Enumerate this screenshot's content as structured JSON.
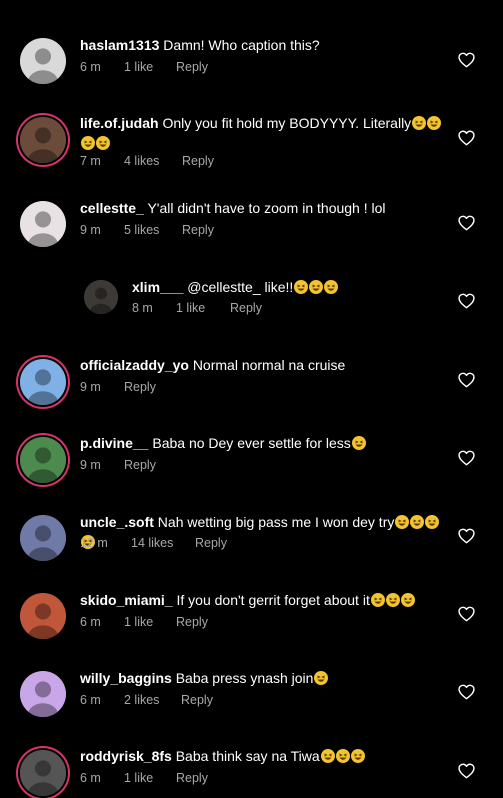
{
  "comments": [
    {
      "user": "haslam1313",
      "text": "Damn! Who caption this?",
      "emojis": 0,
      "time": "6 m",
      "likes": "1 like",
      "reply": "Reply",
      "avatar_color": "#d9d9d9"
    },
    {
      "user": "life.of.judah",
      "text": "Only you fit hold my BODYYYY. Literally",
      "emojis": 4,
      "time": "7 m",
      "likes": "4 likes",
      "reply": "Reply",
      "avatar_color": "#6b4b3a"
    },
    {
      "user": "cellestte_",
      "text": "Y'all didn't have to zoom in though ! lol",
      "emojis": 0,
      "time": "9 m",
      "likes": "5 likes",
      "reply": "Reply",
      "avatar_color": "#e8e2e4"
    },
    {
      "user": "xlim___",
      "text": "@cellestte_ like!!",
      "emojis": 3,
      "time": "8 m",
      "likes": "1 like",
      "reply": "Reply",
      "avatar_color": "#3d3a36"
    },
    {
      "user": "officialzaddy_yo",
      "text": "Normal normal na cruise",
      "emojis": 0,
      "time": "9 m",
      "likes": "",
      "reply": "Reply",
      "avatar_color": "#7fb0e6"
    },
    {
      "user": "p.divine__",
      "text": "Baba no Dey ever settle for less",
      "emojis": 1,
      "time": "9 m",
      "likes": "",
      "reply": "Reply",
      "avatar_color": "#4d8a4d"
    },
    {
      "user": "uncle_.soft",
      "text": "Nah wetting big pass me I won dey try",
      "emojis": 4,
      "time": "12 m",
      "likes": "14 likes",
      "reply": "Reply",
      "avatar_color": "#6f7aa6"
    },
    {
      "user": "skido_miami_",
      "text": "If you don't gerrit forget about it",
      "emojis": 3,
      "time": "6 m",
      "likes": "1 like",
      "reply": "Reply",
      "avatar_color": "#c0563a"
    },
    {
      "user": "willy_baggins",
      "text": "Baba press ynash join",
      "emojis": 1,
      "time": "6 m",
      "likes": "2 likes",
      "reply": "Reply",
      "avatar_color": "#c9a6e8"
    },
    {
      "user": "roddyrisk_8fs",
      "text": "Baba think say na Tiwa",
      "emojis": 3,
      "time": "6 m",
      "likes": "1 like",
      "reply": "Reply",
      "avatar_color": "#555555"
    }
  ],
  "colors": {
    "background": "#000000",
    "meta": "#a8a8a8",
    "story_ring": "#d6336c",
    "emoji": "#f4c430"
  },
  "icons": {
    "like": "heart-outline-icon",
    "emoji": "grinning-squinting-face-emoji"
  }
}
